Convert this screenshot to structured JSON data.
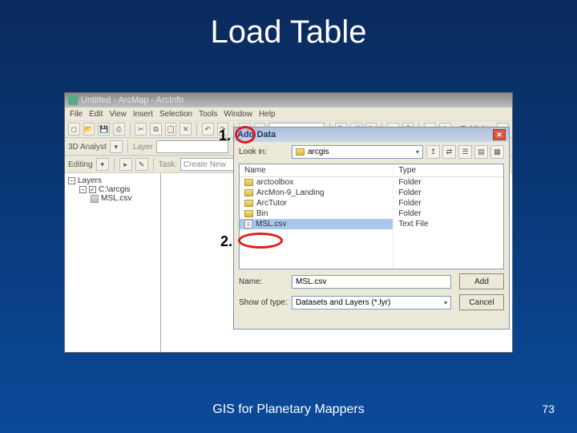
{
  "slide": {
    "title": "Load Table",
    "footer": "GIS for Planetary Mappers",
    "page": "73"
  },
  "callouts": {
    "one": "1.",
    "two": "2."
  },
  "win": {
    "title": "Untitled - ArcMap - ArcInfo",
    "menu": [
      "File",
      "Edit",
      "View",
      "Insert",
      "Selection",
      "Tools",
      "Window",
      "Help"
    ],
    "publisher_label": "Publisher",
    "analyst_label": "3D Analyst",
    "layer_label": "Layer",
    "editing_label": "Editing",
    "task_label": "Task:",
    "task_value": "Create New"
  },
  "toc": {
    "root": "Layers",
    "dataframe": "C:\\arcgis",
    "layer": "MSL.csv"
  },
  "dlg": {
    "title": "Add Data",
    "lookin_label": "Look in:",
    "lookin_value": "arcgis",
    "col_name": "Name",
    "col_type": "Type",
    "rows": {
      "r0": {
        "name": "arctoolbox",
        "type": "Folder"
      },
      "r1": {
        "name": "ArcMon-9_Landing",
        "type": "Folder"
      },
      "r2": {
        "name": "ArcTutor",
        "type": "Folder"
      },
      "r3": {
        "name": "Bin",
        "type": "Folder"
      },
      "r4": {
        "name": "MSL.csv",
        "type": "Text File"
      }
    },
    "name_label": "Name:",
    "name_value": "MSL.csv",
    "type_label": "Show of type:",
    "type_value": "Datasets and Layers (*.lyr)",
    "add": "Add",
    "cancel": "Cancel"
  }
}
